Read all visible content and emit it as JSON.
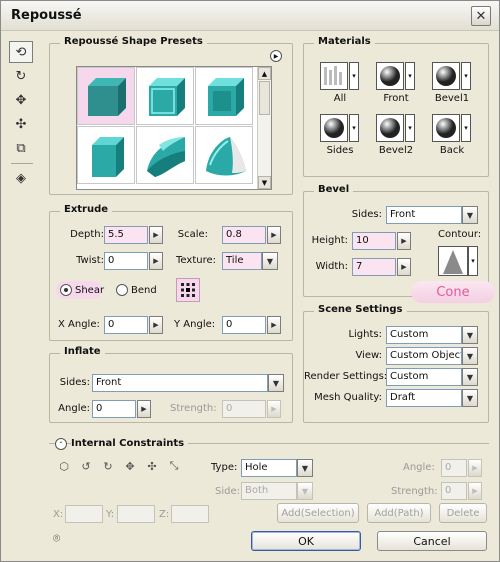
{
  "window": {
    "title": "Repoussé",
    "close_glyph": "✕"
  },
  "toolbar": {
    "tools": [
      {
        "name": "object-rotate-tool-icon",
        "glyph": "⟲"
      },
      {
        "name": "object-roll-tool-icon",
        "glyph": "↻"
      },
      {
        "name": "object-pan-tool-icon",
        "glyph": "✥"
      },
      {
        "name": "object-slide-tool-icon",
        "glyph": "✣"
      },
      {
        "name": "object-scale-tool-icon",
        "glyph": "⧉"
      },
      {
        "name": "camera-tool-icon",
        "glyph": "◈"
      }
    ]
  },
  "presets": {
    "title": "Repoussé Shape Presets",
    "menu_glyph": "▶",
    "selected_index": 0,
    "scroll_up": "▲",
    "scroll_down": "▼"
  },
  "materials": {
    "title": "Materials",
    "dd_glyph": "▾",
    "items": [
      {
        "label": "All"
      },
      {
        "label": "Front"
      },
      {
        "label": "Bevel1"
      },
      {
        "label": "Sides"
      },
      {
        "label": "Bevel2"
      },
      {
        "label": "Back"
      }
    ]
  },
  "extrude": {
    "title": "Extrude",
    "depth_label": "Depth:",
    "depth_value": "5.5",
    "scale_label": "Scale:",
    "scale_value": "0.8",
    "twist_label": "Twist:",
    "twist_value": "0",
    "texture_label": "Texture:",
    "texture_value": "Tile",
    "shear_label": "Shear",
    "bend_label": "Bend",
    "x_angle_label": "X Angle:",
    "x_angle_value": "0",
    "y_angle_label": "Y Angle:",
    "y_angle_value": "0"
  },
  "inflate": {
    "title": "Inflate",
    "sides_label": "Sides:",
    "sides_value": "Front",
    "angle_label": "Angle:",
    "angle_value": "0",
    "strength_label": "Strength:",
    "strength_value": "0"
  },
  "bevel": {
    "title": "Bevel",
    "sides_label": "Sides:",
    "sides_value": "Front",
    "height_label": "Height:",
    "height_value": "10",
    "width_label": "Width:",
    "width_value": "7",
    "contour_label": "Contour:",
    "contour_name": "Cone"
  },
  "scene": {
    "title": "Scene Settings",
    "lights_label": "Lights:",
    "lights_value": "Custom",
    "view_label": "View:",
    "view_value": "Custom Object...",
    "render_label": "Render Settings:",
    "render_value": "Custom",
    "mesh_label": "Mesh Quality:",
    "mesh_value": "Draft"
  },
  "constraints": {
    "title": "Internal Constraints",
    "collapse_glyph": "⌃",
    "type_label": "Type:",
    "type_value": "Hole",
    "side_label": "Side:",
    "side_value": "Both",
    "angle_label": "Angle:",
    "angle_value": "0",
    "strength_label": "Strength:",
    "strength_value": "0",
    "x_label": "X:",
    "y_label": "Y:",
    "z_label": "Z:",
    "add_selection": "Add(Selection)",
    "add_path": "Add(Path)",
    "delete": "Delete",
    "tools": [
      "⬡",
      "↺",
      "↻",
      "✥",
      "✣",
      "⤡"
    ]
  },
  "dialog": {
    "ok": "OK",
    "cancel": "Cancel",
    "preview_glyph": "⌾"
  },
  "glyphs": {
    "spin": "▶",
    "dd": "▼"
  },
  "colors": {
    "teal": "#2aa9a6",
    "teal_dark": "#167f7d",
    "pink": "#f6d8ec",
    "cone_text": "#e4589a"
  }
}
